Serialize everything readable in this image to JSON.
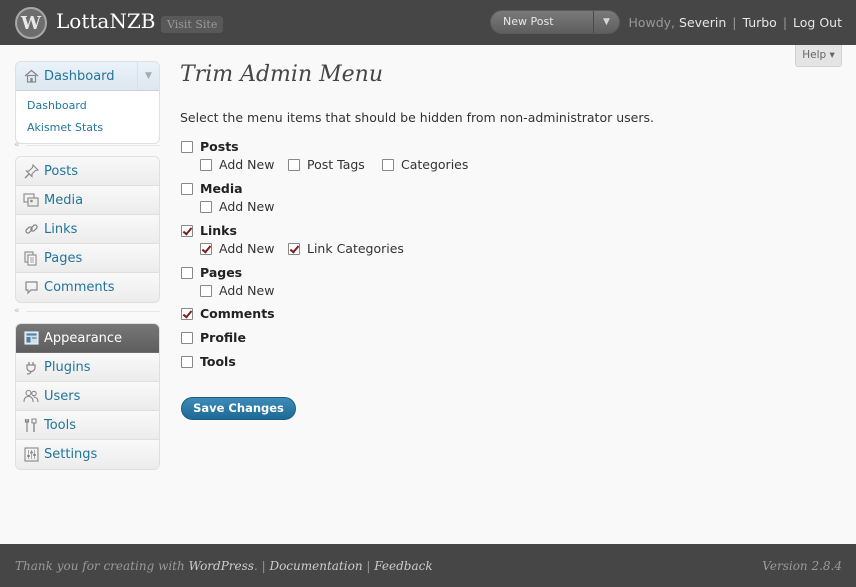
{
  "header": {
    "logo_glyph": "W",
    "site_title": "LottaNZB",
    "visit_site": "Visit Site",
    "favorite_actions": "New Post",
    "howdy": "Howdy,",
    "user_name": "Severin",
    "turbo": "Turbo",
    "logout": "Log Out"
  },
  "help": "Help ▾",
  "sidebar": {
    "dashboard": {
      "label": "Dashboard",
      "subitems": [
        "Dashboard",
        "Akismet Stats"
      ]
    },
    "group1": [
      "Posts",
      "Media",
      "Links",
      "Pages",
      "Comments"
    ],
    "group2": [
      "Appearance",
      "Plugins",
      "Users",
      "Tools",
      "Settings"
    ],
    "current": "Appearance",
    "icons": [
      "pushpin-icon",
      "media-icon",
      "link-icon",
      "pages-icon",
      "comments-icon",
      "appearance-icon",
      "plugins-icon",
      "users-icon",
      "tools-icon",
      "settings-icon"
    ]
  },
  "main": {
    "title": "Trim Admin Menu",
    "intro": "Select the menu items that should be hidden from non-administrator users.",
    "options": {
      "posts": {
        "label": "Posts",
        "checked": false
      },
      "posts_add_new": {
        "label": "Add New",
        "checked": false
      },
      "posts_tags": {
        "label": "Post Tags",
        "checked": false
      },
      "posts_categories": {
        "label": "Categories",
        "checked": false
      },
      "media": {
        "label": "Media",
        "checked": false
      },
      "media_add_new": {
        "label": "Add New",
        "checked": false
      },
      "links": {
        "label": "Links",
        "checked": true
      },
      "links_add_new": {
        "label": "Add New",
        "checked": true
      },
      "links_categories": {
        "label": "Link Categories",
        "checked": true
      },
      "pages": {
        "label": "Pages",
        "checked": false
      },
      "pages_add_new": {
        "label": "Add New",
        "checked": false
      },
      "comments": {
        "label": "Comments",
        "checked": true
      },
      "profile": {
        "label": "Profile",
        "checked": false
      },
      "tools": {
        "label": "Tools",
        "checked": false
      }
    },
    "save_label": "Save Changes"
  },
  "footer": {
    "thanks": "Thank you for creating with",
    "wordpress": "WordPress",
    "documentation": "Documentation",
    "feedback": "Feedback",
    "version": "Version 2.8.4"
  },
  "colors": {
    "header_bg": "#464646",
    "link": "#21759b",
    "button": "#21759b",
    "check": "#7a1d1d"
  }
}
